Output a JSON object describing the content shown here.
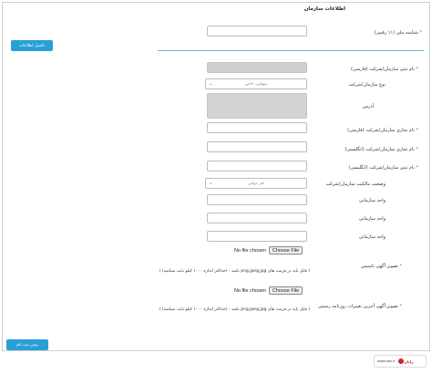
{
  "section": {
    "legend": "اطلاعات سازمان"
  },
  "national_id": {
    "label": "شناسه ملی (۱۱ رقمی)",
    "value": ""
  },
  "complete_info_button": "تکمیل اطلاعات",
  "fields": {
    "registered_name_fa": "نام ثبتی سازمان/شرکت (فارسی)",
    "org_type": {
      "label": "نوع سازمان/شرکت",
      "selected": "سهامی خاص"
    },
    "address": "آدرس",
    "trade_name_fa": "نام تجاری سازمان/شرکت (فارسی)",
    "trade_name_en": "نام تجاری سازمان/شرکت (انگلیسی)",
    "registered_name_en": "نام ثبتی سازمان/شرکت (انگلیسی)",
    "ownership": {
      "label": "وضعیت مالکیت سازمان/شرکت",
      "selected": "غیر دولتی"
    },
    "unit_1": "واحد سازمانی",
    "unit_2": "واحد سازمانی",
    "unit_3": "واحد سازمانی"
  },
  "upload_1": {
    "label": "تصویر آگهی تاسیس",
    "button": "Choose File",
    "status": "No file chosen",
    "note": "( فایل باید در فرمت های png,jpeg,jpg باشد - (حداکثر اندازه ۱۰۰۰ کیلو بایت میباشد) )"
  },
  "upload_2": {
    "label": "تصویر آگهی آخرین تغییرات روزنامه رسمی",
    "button": "Choose File",
    "status": "No file chosen",
    "note": "( فایل باید در فرمت های png,jpeg,jpg باشد - (حداکثر اندازه ۱۰۰۰ کیلو بایت میباشد) )"
  },
  "submit_button": "پیش ثبت نام",
  "footer": {
    "url": "www.rws.ir",
    "logo_text": "رایان"
  }
}
